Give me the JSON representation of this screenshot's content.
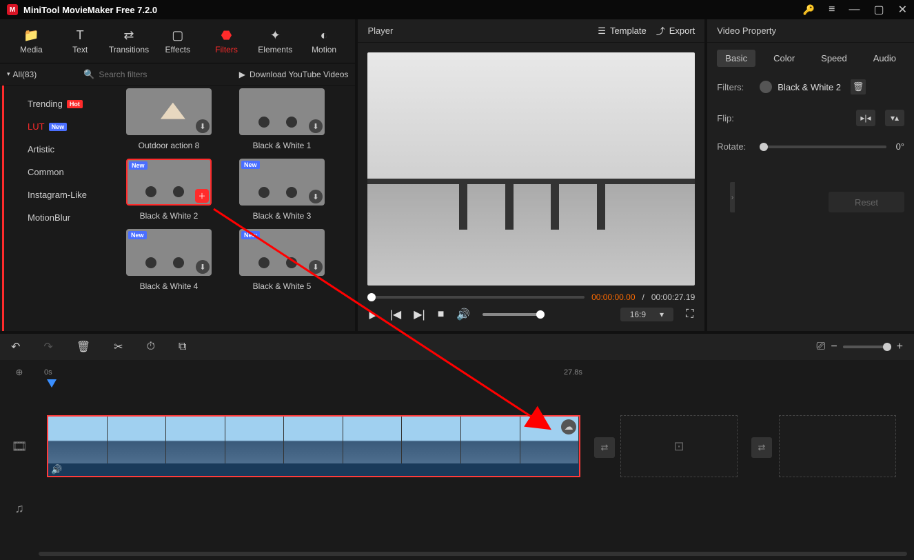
{
  "app": {
    "title": "MiniTool MovieMaker Free 7.2.0"
  },
  "toolbar_tabs": {
    "media": "Media",
    "text": "Text",
    "transitions": "Transitions",
    "effects": "Effects",
    "filters": "Filters",
    "elements": "Elements",
    "motion": "Motion"
  },
  "subbar": {
    "all": "All(83)",
    "search_placeholder": "Search filters",
    "download": "Download YouTube Videos"
  },
  "categories": [
    {
      "label": "Trending",
      "badge": "Hot"
    },
    {
      "label": "LUT",
      "badge": "New",
      "active": true
    },
    {
      "label": "Artistic"
    },
    {
      "label": "Common"
    },
    {
      "label": "Instagram-Like"
    },
    {
      "label": "MotionBlur"
    }
  ],
  "filters": {
    "r1a": "Outdoor action 8",
    "r1b": "Black & White 1",
    "r2a": "Black & White 2",
    "r2b": "Black & White 3",
    "r3a": "Black & White 4",
    "r3b": "Black & White 5",
    "new_badge": "New"
  },
  "player": {
    "title": "Player",
    "template": "Template",
    "export": "Export",
    "time_cur": "00:00:00.00",
    "time_sep": " / ",
    "time_tot": "00:00:27.19",
    "ratio": "16:9"
  },
  "props": {
    "title": "Video Property",
    "tab_basic": "Basic",
    "tab_color": "Color",
    "tab_speed": "Speed",
    "tab_audio": "Audio",
    "filters_label": "Filters:",
    "filter_name": "Black & White 2",
    "flip_label": "Flip:",
    "rotate_label": "Rotate:",
    "rotate_value": "0°",
    "reset": "Reset"
  },
  "timeline": {
    "mark0": "0s",
    "mark_end": "27.8s"
  }
}
